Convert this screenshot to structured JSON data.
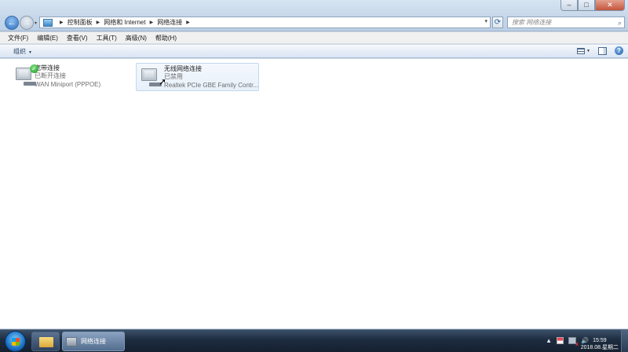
{
  "window": {
    "controls": {
      "minimize": "–",
      "maximize": "□",
      "close": "✕"
    }
  },
  "nav": {
    "back_glyph": "←",
    "forward_glyph": "→"
  },
  "address": {
    "breadcrumbs": [
      "控制面板",
      "网络和 Internet",
      "网络连接"
    ],
    "dropdown_glyph": "▾"
  },
  "search": {
    "placeholder": "搜索 网络连接"
  },
  "menu": [
    "文件(F)",
    "编辑(E)",
    "查看(V)",
    "工具(T)",
    "高级(N)",
    "帮助(H)"
  ],
  "toolbar": {
    "organize": "组织",
    "help": "?"
  },
  "connections": [
    {
      "name": "宽带连接",
      "status": "已断开连接",
      "device": "WAN Miniport (PPPOE)",
      "icon": "dialup-connection-icon",
      "badge": "check"
    },
    {
      "name": "无线网络连接",
      "status": "已禁用",
      "device": "Realtek PCIe GBE Family Contr...",
      "icon": "network-adapter-icon"
    }
  ],
  "taskbar": {
    "window_button_label": "网络连接",
    "clock_time": "15:59",
    "clock_date": "2018.08.星期二"
  },
  "colors": {
    "accent": "#2d6fbf",
    "selection_bg": "#e7f0fa",
    "taskbar": "#1d2c3f"
  }
}
